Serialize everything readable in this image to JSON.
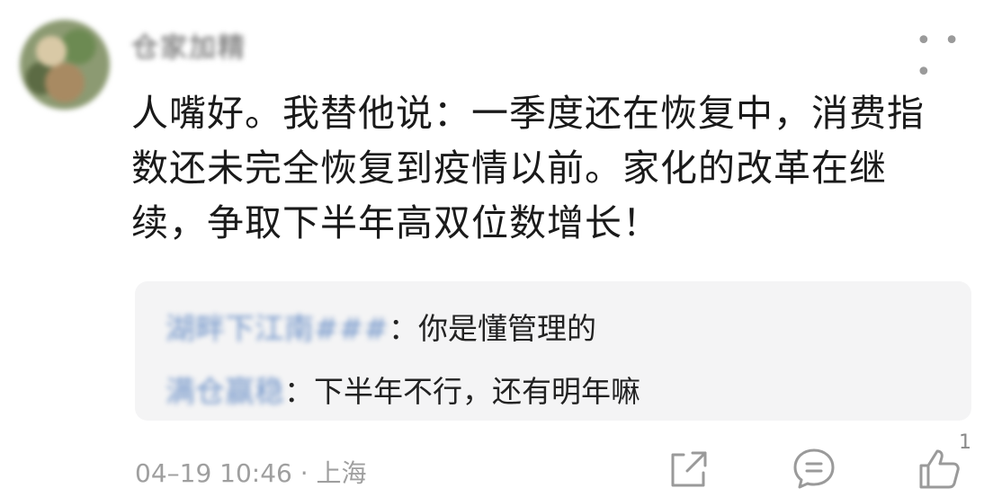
{
  "comment": {
    "username": "仓家加精",
    "more_icon": "more-dots-icon",
    "lines": [
      "人嘴好。我替他说：一季度还在恢复中，消费指",
      "数还未完全恢复到疫情以前。家化的改革在继",
      "续，争取下半年高双位数增长！"
    ],
    "replies": [
      {
        "name": "湖畔下江南###",
        "separator": "：",
        "text": "你是懂管理的"
      },
      {
        "name": "满仓赢稳",
        "separator": "：",
        "text": "下半年不行，还有明年嘛"
      }
    ],
    "meta": "04–19 10:46 · 上海",
    "actions": {
      "share_icon": "share-icon",
      "reply_icon": "comment-icon",
      "like_icon": "thumbs-up-icon",
      "like_count": "1"
    }
  },
  "colors": {
    "text": "#1a1a1a",
    "muted": "#9f9f9f",
    "reply_bg": "#f4f4f5",
    "reply_name": "#6f93c8"
  }
}
